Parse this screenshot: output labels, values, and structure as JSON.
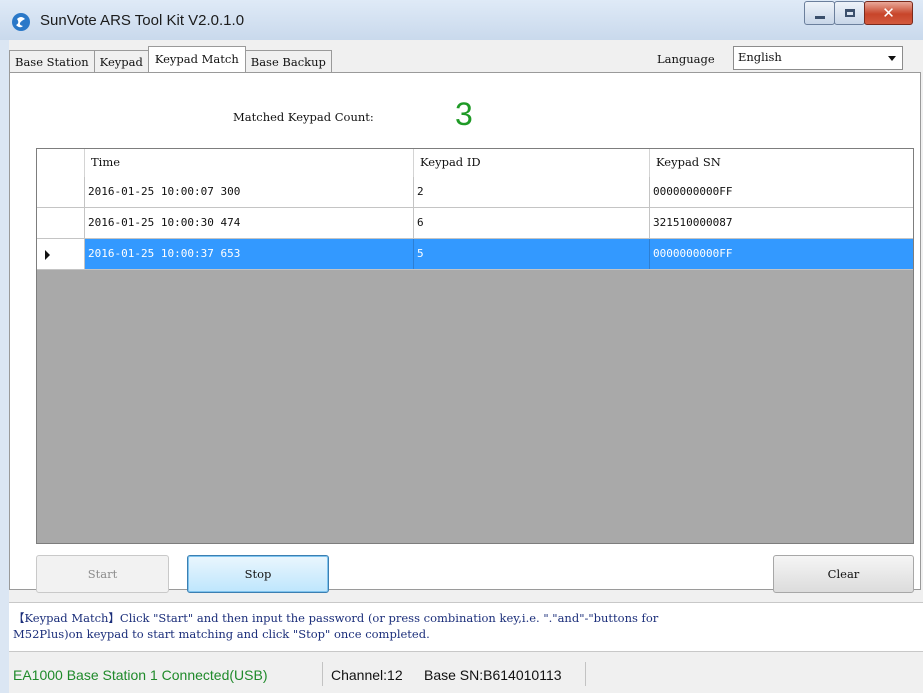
{
  "window": {
    "title": "SunVote ARS Tool Kit  V2.0.1.0"
  },
  "tabs": [
    {
      "label": "Base Station",
      "active": false
    },
    {
      "label": "Keypad",
      "active": false
    },
    {
      "label": "Keypad Match",
      "active": true
    },
    {
      "label": "Base Backup",
      "active": false
    }
  ],
  "language": {
    "label": "Language",
    "selected": "English"
  },
  "match": {
    "count_label": "Matched Keypad Count:",
    "count_value": "3"
  },
  "table": {
    "columns": [
      "Time",
      "Keypad ID",
      "Keypad SN"
    ],
    "rows": [
      {
        "time": "2016-01-25 10:00:07 300",
        "keypad_id": "2",
        "keypad_sn": "0000000000FF",
        "selected": false
      },
      {
        "time": "2016-01-25 10:00:30 474",
        "keypad_id": "6",
        "keypad_sn": "321510000087",
        "selected": false
      },
      {
        "time": "2016-01-25 10:00:37 653",
        "keypad_id": "5",
        "keypad_sn": "0000000000FF",
        "selected": true
      }
    ]
  },
  "buttons": {
    "start": "Start",
    "stop": "Stop",
    "clear": "Clear"
  },
  "help": {
    "line1": "【Keypad Match】Click \"Start\" and then input the password (or press combination key,i.e. \".\"and\"-\"buttons for",
    "line2": "M52Plus)on keypad to start matching and click \"Stop\" once completed."
  },
  "status": {
    "connection": "EA1000  Base Station 1 Connected(USB)",
    "channel": "Channel:12",
    "base_sn": "Base SN:B614010113"
  },
  "colors": {
    "count": "#1f9a26",
    "selection": "#3399ff",
    "status_green": "#1f8a2a"
  },
  "icons": {
    "app": "sunvote-logo-icon",
    "minimize": "minimize-icon",
    "maximize": "maximize-icon",
    "close": "close-icon",
    "dropdown": "chevron-down-icon",
    "row_pointer": "row-pointer-icon"
  }
}
